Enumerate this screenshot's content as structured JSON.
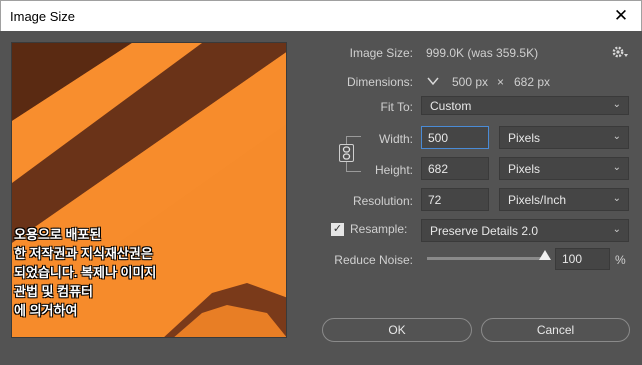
{
  "window": {
    "title": "Image Size",
    "close_glyph": "✕"
  },
  "preview": {
    "overlay_lines": [
      "오용으로 배포된",
      "한 저작권과 지식재산권은",
      "되었습니다. 복제나 이미지",
      "관법 및 컴퓨터",
      "에 의거하여"
    ]
  },
  "image_size": {
    "label": "Image Size:",
    "value": "999.0K (was 359.5K)"
  },
  "dimensions": {
    "label": "Dimensions:",
    "width": "500 px",
    "times": "×",
    "height": "682 px"
  },
  "fit_to": {
    "label": "Fit To:",
    "value": "Custom"
  },
  "width": {
    "label": "Width:",
    "value": "500",
    "unit": "Pixels"
  },
  "height": {
    "label": "Height:",
    "value": "682",
    "unit": "Pixels"
  },
  "resolution": {
    "label": "Resolution:",
    "value": "72",
    "unit": "Pixels/Inch"
  },
  "resample": {
    "label": "Resample:",
    "checked": true,
    "value": "Preserve Details 2.0"
  },
  "reduce_noise": {
    "label": "Reduce Noise:",
    "value": "100",
    "unit": "%",
    "level": 1.0
  },
  "buttons": {
    "ok": "OK",
    "cancel": "Cancel"
  }
}
